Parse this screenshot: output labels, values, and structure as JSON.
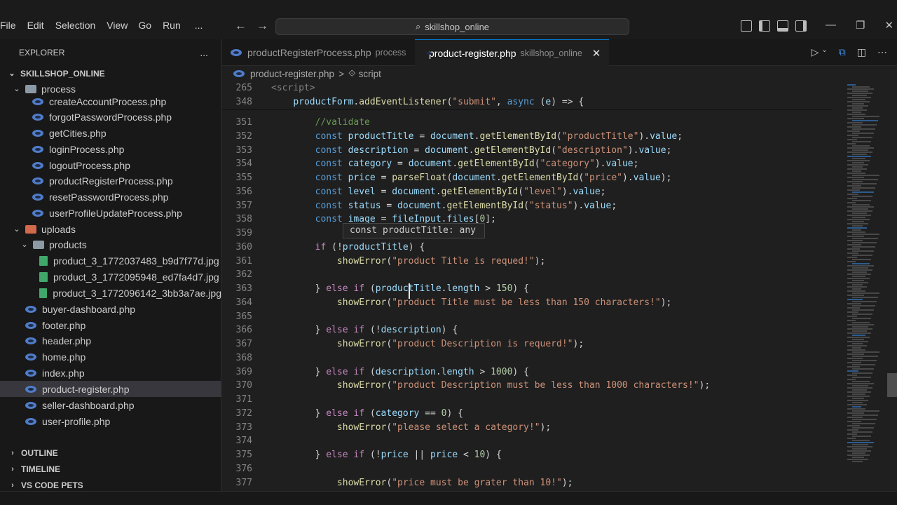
{
  "menu": [
    "File",
    "Edit",
    "Selection",
    "View",
    "Go",
    "Run",
    "..."
  ],
  "search": {
    "text": "skillshop_online"
  },
  "sidebar": {
    "title": "EXPLORER",
    "more": "...",
    "root": "SKILLSHOP_ONLINE",
    "folder_process": "process",
    "process_files": [
      "createAccountProcess.php",
      "forgotPasswordProcess.php",
      "getCities.php",
      "loginProcess.php",
      "logoutProcess.php",
      "productRegisterProcess.php",
      "resetPasswordProcess.php",
      "userProfileUpdateProcess.php"
    ],
    "folder_uploads": "uploads",
    "folder_products": "products",
    "product_images": [
      "product_3_1772037483_b9d7f77d.jpg",
      "product_3_1772095948_ed7fa4d7.jpg",
      "product_3_1772096142_3bb3a7ae.jpg"
    ],
    "root_files": [
      "buyer-dashboard.php",
      "footer.php",
      "header.php",
      "home.php",
      "index.php",
      "product-register.php",
      "seller-dashboard.php",
      "user-profile.php"
    ],
    "panels": [
      "OUTLINE",
      "TIMELINE",
      "VS CODE PETS"
    ]
  },
  "tabs": [
    {
      "label": "productRegisterProcess.php",
      "sub": "process",
      "active": false
    },
    {
      "label": "product-register.php",
      "sub": "skillshop_online",
      "active": true
    }
  ],
  "breadcrumb": {
    "file": "product-register.php",
    "sep": ">",
    "symbol": "script"
  },
  "code": {
    "sticky": [
      {
        "ln": "265",
        "text": "<script>"
      },
      {
        "ln": "348",
        "text": "    productForm.addEventListener(\"submit\", async (e) => {"
      }
    ],
    "lines": [
      {
        "ln": "351",
        "text": "        //validate"
      },
      {
        "ln": "352",
        "text": "        const productTitle = document.getElementById(\"productTitle\").value;"
      },
      {
        "ln": "353",
        "text": "        const description = document.getElementById(\"description\").value;"
      },
      {
        "ln": "354",
        "text": "        const category = document.getElementById(\"category\").value;"
      },
      {
        "ln": "355",
        "text": "        const price = parseFloat(document.getElementById(\"price\").value);"
      },
      {
        "ln": "356",
        "text": "        const level = document.getElementById(\"level\").value;"
      },
      {
        "ln": "357",
        "text": "        const status = document.getElementById(\"status\").value;"
      },
      {
        "ln": "358",
        "text": "        const image = fileInput.files[0];"
      },
      {
        "ln": "359",
        "text": ""
      },
      {
        "ln": "360",
        "text": "        if (!productTitle) {"
      },
      {
        "ln": "361",
        "text": "            showError(\"product Title is requed!\");"
      },
      {
        "ln": "362",
        "text": ""
      },
      {
        "ln": "363",
        "text": "        } else if (productTitle.length > 150) {"
      },
      {
        "ln": "364",
        "text": "            showError(\"product Title must be less than 150 characters!\");"
      },
      {
        "ln": "365",
        "text": ""
      },
      {
        "ln": "366",
        "text": "        } else if (!description) {"
      },
      {
        "ln": "367",
        "text": "            showError(\"product Description is requerd!\");"
      },
      {
        "ln": "368",
        "text": ""
      },
      {
        "ln": "369",
        "text": "        } else if (description.length > 1000) {"
      },
      {
        "ln": "370",
        "text": "            showError(\"product Description must be less than 1000 characters!\");"
      },
      {
        "ln": "371",
        "text": ""
      },
      {
        "ln": "372",
        "text": "        } else if (category == 0) {"
      },
      {
        "ln": "373",
        "text": "            showError(\"please select a category!\");"
      },
      {
        "ln": "374",
        "text": ""
      },
      {
        "ln": "375",
        "text": "        } else if (!price || price < 10) {"
      },
      {
        "ln": "376",
        "text": ""
      },
      {
        "ln": "377",
        "text": "            showError(\"price must be grater than 10!\");"
      }
    ],
    "hover_tooltip": "const productTitle: any"
  }
}
